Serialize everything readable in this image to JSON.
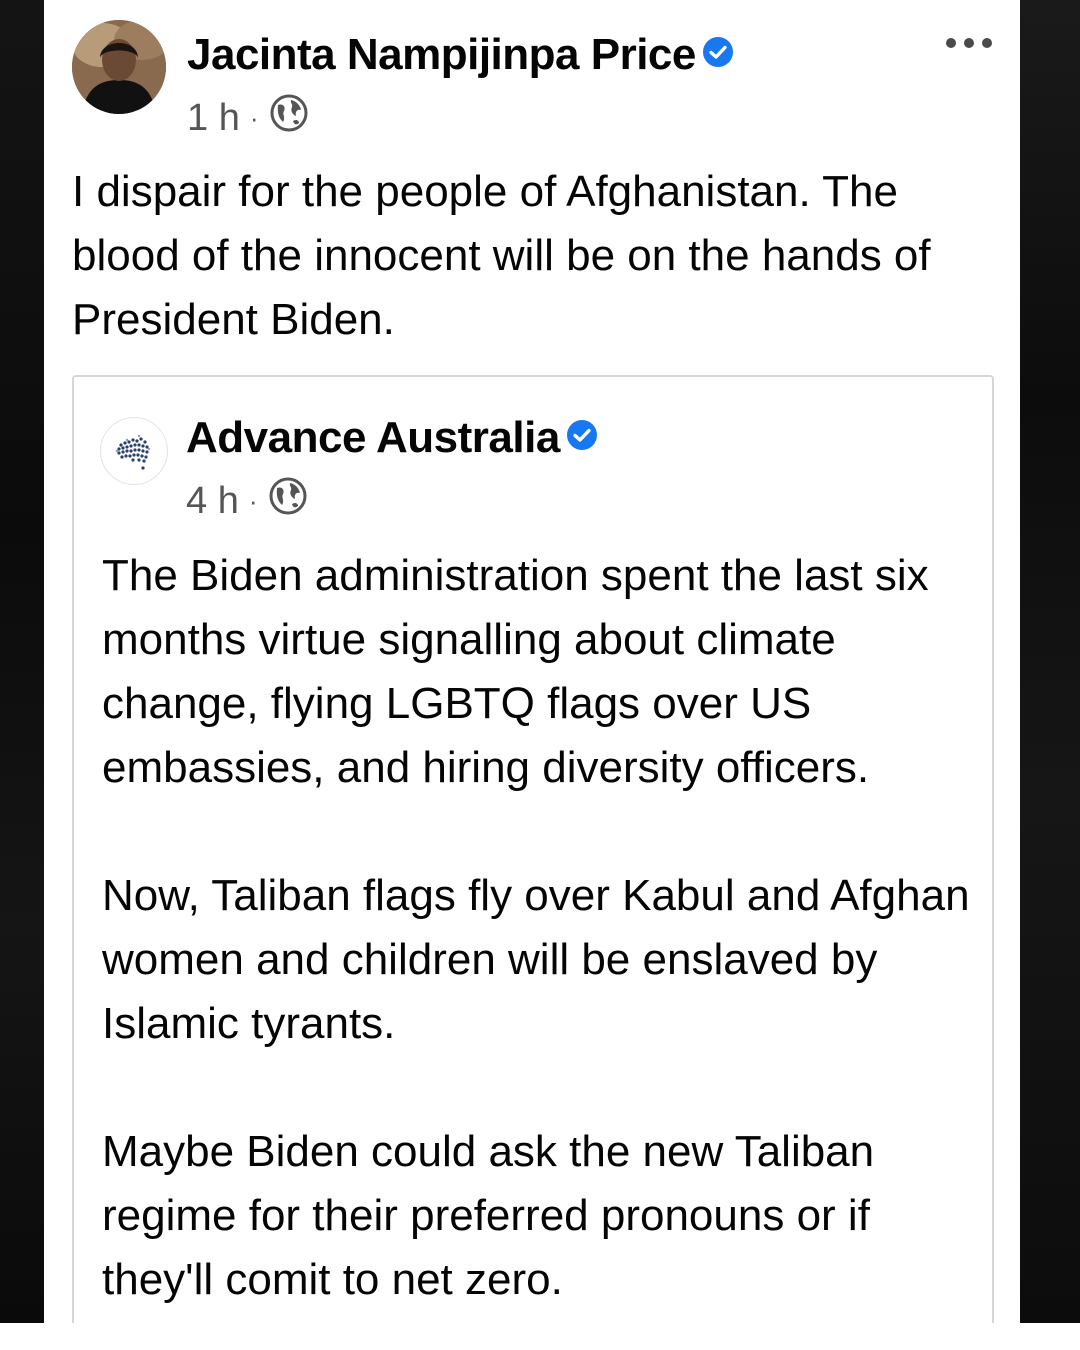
{
  "post": {
    "author": "Jacinta Nampijinpa Price",
    "time": "1 h",
    "separator": "·",
    "privacy_icon": "globe-icon",
    "more_icon": "ellipsis-icon",
    "text": "I dispair for the people of Afghanistan. The blood of the innocent will be on the hands of President Biden."
  },
  "shared_post": {
    "author": "Advance Australia",
    "time": "4 h",
    "separator": "·",
    "privacy_icon": "globe-icon",
    "paragraphs": [
      "The Biden administration spent the last six months virtue signalling about climate change, flying LGBTQ flags over US embassies, and hiring diversity officers.",
      "Now, Taliban flags fly over Kabul and Afghan women and children will be enslaved by Islamic tyrants.",
      "Maybe Biden could ask the new Taliban regime for their preferred pronouns or if they'll comit to net zero."
    ]
  },
  "colors": {
    "verified_badge": "#1877f2",
    "text": "#050505",
    "meta_text": "#555555"
  }
}
